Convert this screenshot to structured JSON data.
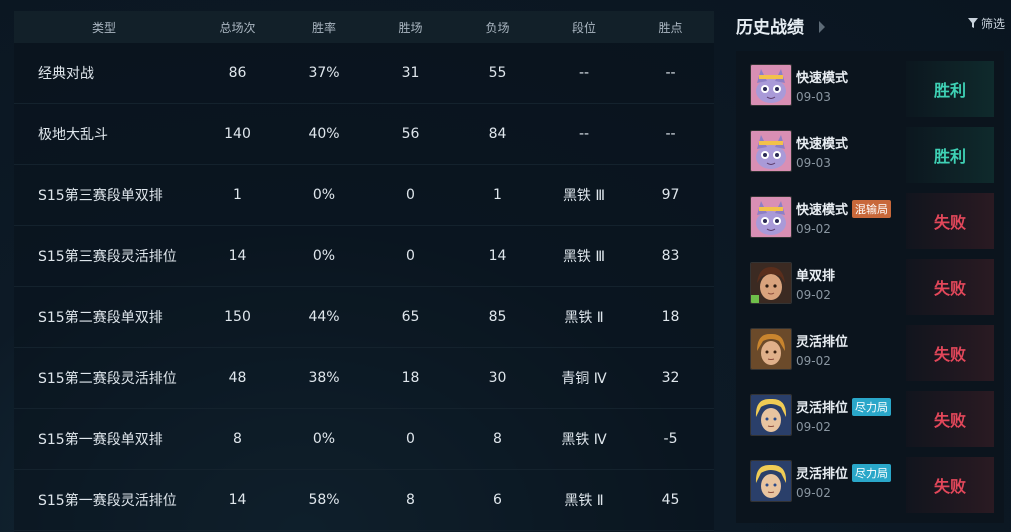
{
  "table": {
    "headers": [
      "类型",
      "总场次",
      "胜率",
      "胜场",
      "负场",
      "段位",
      "胜点"
    ],
    "rows": [
      {
        "type": "经典对战",
        "total": "86",
        "rate": "37%",
        "wins": "31",
        "losses": "55",
        "rank": "--",
        "points": "--"
      },
      {
        "type": "极地大乱斗",
        "total": "140",
        "rate": "40%",
        "wins": "56",
        "losses": "84",
        "rank": "--",
        "points": "--"
      },
      {
        "type": "S15第三赛段单双排",
        "total": "1",
        "rate": "0%",
        "wins": "0",
        "losses": "1",
        "rank": "黑铁 Ⅲ",
        "points": "97"
      },
      {
        "type": "S15第三赛段灵活排位",
        "total": "14",
        "rate": "0%",
        "wins": "0",
        "losses": "14",
        "rank": "黑铁 Ⅲ",
        "points": "83"
      },
      {
        "type": "S15第二赛段单双排",
        "total": "150",
        "rate": "44%",
        "wins": "65",
        "losses": "85",
        "rank": "黑铁 Ⅱ",
        "points": "18"
      },
      {
        "type": "S15第二赛段灵活排位",
        "total": "48",
        "rate": "38%",
        "wins": "18",
        "losses": "30",
        "rank": "青铜 Ⅳ",
        "points": "32"
      },
      {
        "type": "S15第一赛段单双排",
        "total": "8",
        "rate": "0%",
        "wins": "0",
        "losses": "8",
        "rank": "黑铁 Ⅳ",
        "points": "-5"
      },
      {
        "type": "S15第一赛段灵活排位",
        "total": "14",
        "rate": "58%",
        "wins": "8",
        "losses": "6",
        "rank": "黑铁 Ⅱ",
        "points": "45"
      }
    ]
  },
  "history": {
    "title": "历史战绩",
    "filter_label": "筛选",
    "matches": [
      {
        "mode": "快速模式",
        "date": "09-03",
        "result": "胜利",
        "outcome": "win",
        "tag": "",
        "champion_icon": "cat-champion-icon"
      },
      {
        "mode": "快速模式",
        "date": "09-03",
        "result": "胜利",
        "outcome": "win",
        "tag": "",
        "champion_icon": "cat-champion-icon"
      },
      {
        "mode": "快速模式",
        "date": "09-02",
        "result": "失败",
        "outcome": "loss",
        "tag": "混输局",
        "tag_color": "#c8683a",
        "champion_icon": "cat-champion-icon"
      },
      {
        "mode": "单双排",
        "date": "09-02",
        "result": "失败",
        "outcome": "loss",
        "tag": "",
        "champion_icon": "girl-champion-icon"
      },
      {
        "mode": "灵活排位",
        "date": "09-02",
        "result": "失败",
        "outcome": "loss",
        "tag": "",
        "champion_icon": "warrior-champion-icon"
      },
      {
        "mode": "灵活排位",
        "date": "09-02",
        "result": "失败",
        "outcome": "loss",
        "tag": "尽力局",
        "tag_color": "#2aa7c9",
        "champion_icon": "blonde-champion-icon"
      },
      {
        "mode": "灵活排位",
        "date": "09-02",
        "result": "失败",
        "outcome": "loss",
        "tag": "尽力局",
        "tag_color": "#2aa7c9",
        "champion_icon": "blonde-champion-icon"
      }
    ]
  }
}
